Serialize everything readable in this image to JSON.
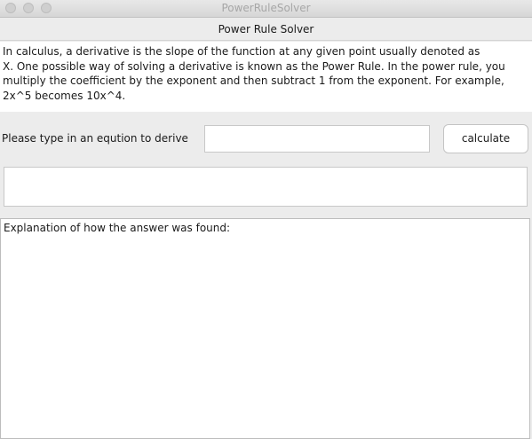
{
  "window": {
    "title": "PowerRuleSolver"
  },
  "header": {
    "title": "Power Rule Solver"
  },
  "description": {
    "lines": [
      "In calculus, a derivative is the slope of the function at any given point usually denoted as",
      " X. One possible way of solving a derivative is known as the Power Rule. In the power rule, you",
      " multiply the coefficient by the exponent and then subtract 1 from the exponent. For example,",
      " 2x^5 becomes 10x^4."
    ]
  },
  "input_row": {
    "label": "Please type in an eqution to derive",
    "value": "",
    "button_label": "calculate"
  },
  "result": {
    "text": ""
  },
  "explanation": {
    "text": "Explanation of how the answer was found:"
  }
}
